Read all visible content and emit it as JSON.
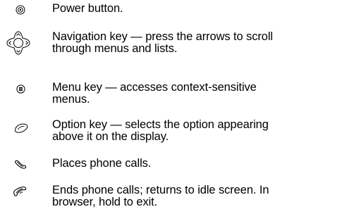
{
  "items": [
    {
      "icon": "power-button-icon",
      "lines": [
        "Power button."
      ]
    },
    {
      "icon": "navigation-key-icon",
      "lines": [
        "Navigation key — press the arrows to scroll",
        "through menus and lists."
      ]
    },
    {
      "icon": "menu-key-icon",
      "lines": [
        "Menu key — accesses context-sensitive",
        "menus."
      ]
    },
    {
      "icon": "option-key-icon",
      "lines": [
        "Option key — selects the option appearing",
        "above it on the display."
      ]
    },
    {
      "icon": "send-call-key-icon",
      "lines": [
        "Places phone calls."
      ]
    },
    {
      "icon": "end-call-key-icon",
      "lines": [
        "Ends phone calls; returns to idle screen. In",
        "browser, hold to exit."
      ]
    }
  ]
}
